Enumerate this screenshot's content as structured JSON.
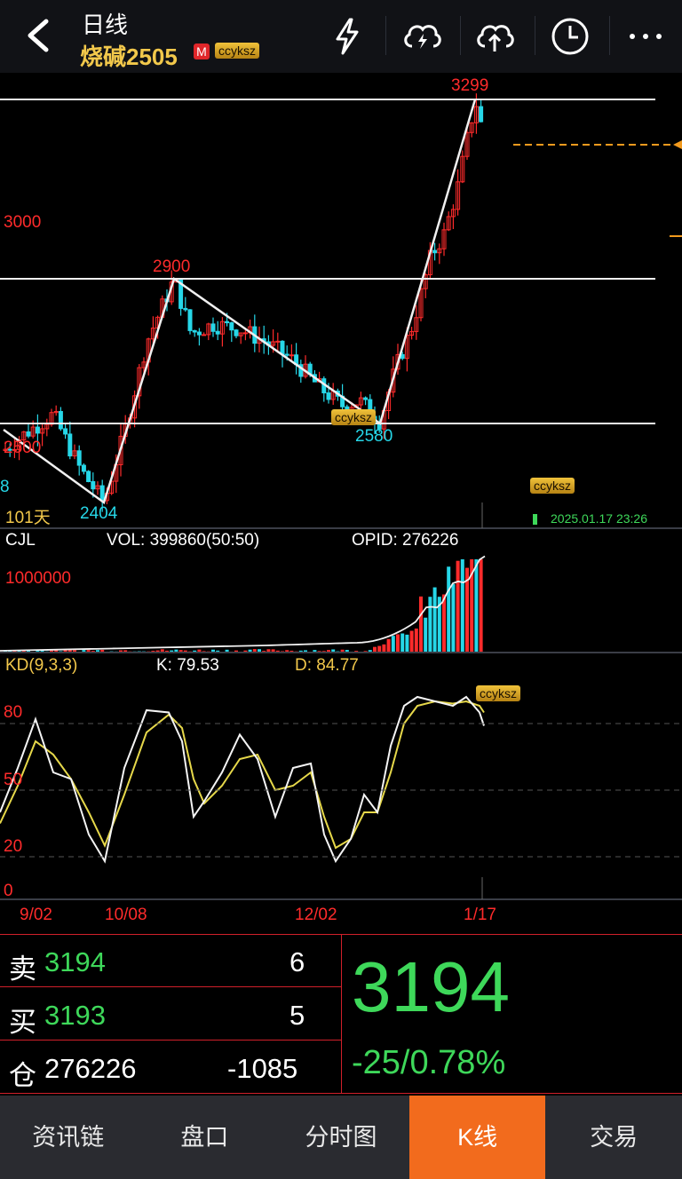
{
  "header": {
    "period": "日线",
    "instrument": "烧碱2505",
    "badge": "M",
    "watermark": "ccyksz",
    "icons": [
      "lightning-icon",
      "cloud-lightning-icon",
      "cloud-upload-icon",
      "clock-icon",
      "more-icon"
    ]
  },
  "main_chart": {
    "y_label_3000": "3000",
    "y_label_2500": "2500",
    "high_label": "3299",
    "peak_label": "2900",
    "low_label_1": "2580",
    "low_label_2": "2404",
    "days_label": "101天",
    "edge_label": "8",
    "timestamp": "2025.01.17 23:26",
    "watermark_1": "ccyksz",
    "watermark_2": "ccyksz"
  },
  "volume_panel": {
    "name": "CJL",
    "vol": "VOL: 399860(50:50)",
    "opid": "OPID: 276226",
    "scale": "1000000"
  },
  "kd_panel": {
    "name": "KD(9,3,3)",
    "k": "K: 79.53",
    "d": "D: 84.77",
    "levels": [
      "80",
      "50",
      "20",
      "0"
    ],
    "watermark": "ccyksz"
  },
  "x_axis": [
    "9/02",
    "10/08",
    "12/02",
    "1/17"
  ],
  "quote": {
    "sell_label": "卖",
    "sell_price": "3194",
    "sell_qty": "6",
    "buy_label": "买",
    "buy_price": "3193",
    "buy_qty": "5",
    "oi_label": "仓",
    "oi_value": "276226",
    "oi_change": "-1085",
    "last_price": "3194",
    "change": "-25/0.78%"
  },
  "tabs": [
    "资讯链",
    "盘口",
    "分时图",
    "K线",
    "交易"
  ],
  "colors": {
    "up": "#ff2b2b",
    "down": "#26d7e8",
    "price_green": "#3ed85a",
    "accent": "#f26b1d",
    "gold": "#f2c84b"
  },
  "chart_data": {
    "type": "candlestick",
    "price_range": [
      2380,
      3320
    ],
    "x_labels": [
      "9/02",
      "10/08",
      "12/02",
      "1/17"
    ],
    "annotated_levels": {
      "high": 3299,
      "peak": 2900,
      "low_1": 2580,
      "low_2": 2404
    },
    "reference_levels": [
      3000,
      2500
    ],
    "kd": {
      "K": 79.53,
      "D": 84.77,
      "levels": [
        80,
        50,
        20,
        0
      ]
    },
    "volume": {
      "VOL": 399860,
      "OPID": 276226,
      "scale": 1000000
    }
  }
}
